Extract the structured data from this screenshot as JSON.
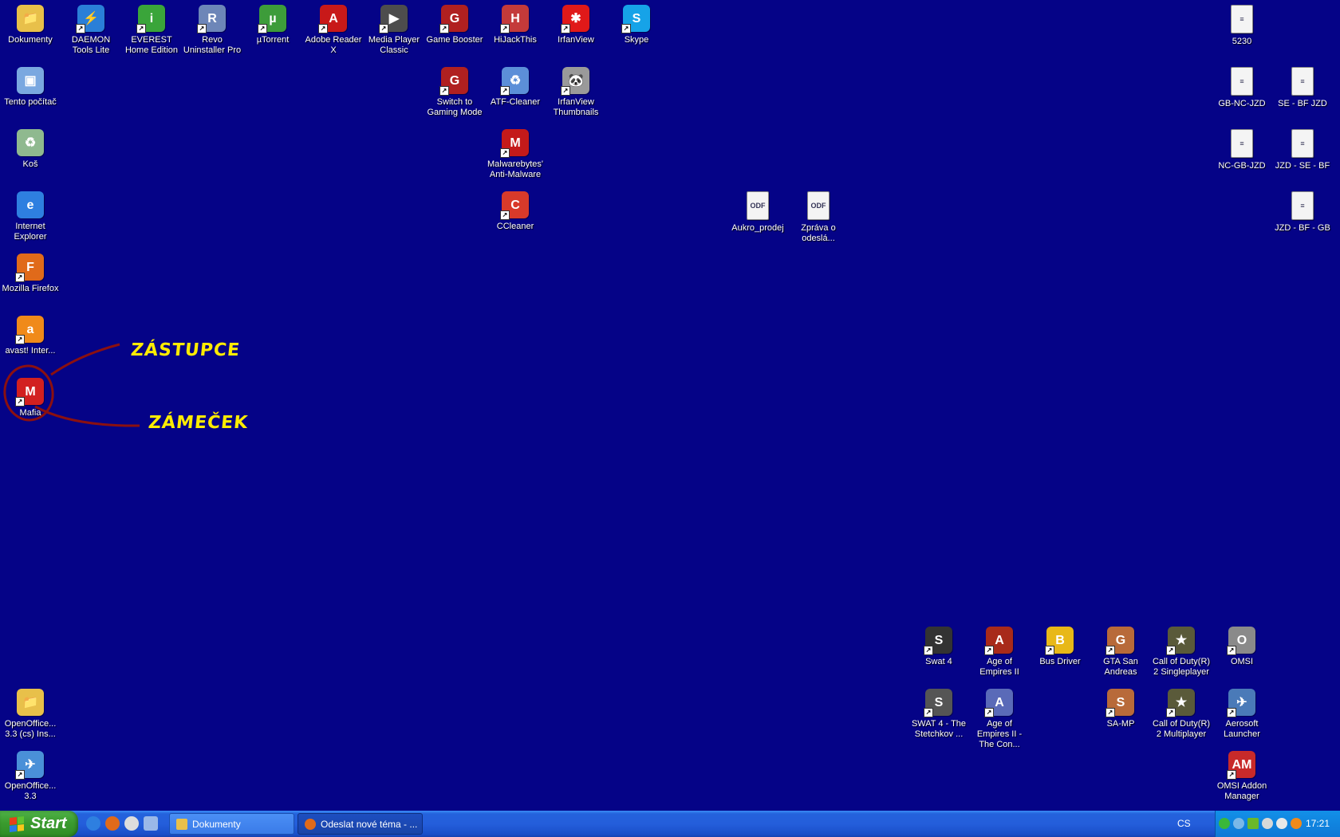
{
  "desktop": {
    "icons": [
      {
        "label": "Dokumenty",
        "abbr": "📁",
        "color": "#e8c04a",
        "shortcut": false
      },
      {
        "label": "DAEMON Tools Lite",
        "abbr": "⚡",
        "color": "#2a7fd8",
        "shortcut": true
      },
      {
        "label": "EVEREST Home Edition",
        "abbr": "i",
        "color": "#3aa53a",
        "shortcut": true
      },
      {
        "label": "Revo Uninstaller Pro",
        "abbr": "R",
        "color": "#6d86b8",
        "shortcut": true
      },
      {
        "label": "µTorrent",
        "abbr": "µ",
        "color": "#3d9c3a",
        "shortcut": true
      },
      {
        "label": "Adobe Reader X",
        "abbr": "A",
        "color": "#c81919",
        "shortcut": true
      },
      {
        "label": "Media Player Classic",
        "abbr": "▶",
        "color": "#4d4d4d",
        "shortcut": true
      },
      {
        "label": "Game Booster",
        "abbr": "G",
        "color": "#b02020",
        "shortcut": true
      },
      {
        "label": "HiJackThis",
        "abbr": "H",
        "color": "#c43a3a",
        "shortcut": true
      },
      {
        "label": "IrfanView",
        "abbr": "✱",
        "color": "#e01919",
        "shortcut": true
      },
      {
        "label": "Skype",
        "abbr": "S",
        "color": "#16a3e8",
        "shortcut": true
      },
      {
        "label": "Tento počítač",
        "abbr": "▣",
        "color": "#7aa8e0",
        "shortcut": false
      },
      {
        "label": "Koš",
        "abbr": "♻",
        "color": "#8fb98f",
        "shortcut": false
      },
      {
        "label": "Internet Explorer",
        "abbr": "e",
        "color": "#2e7fe0",
        "shortcut": false
      },
      {
        "label": "Mozilla Firefox",
        "abbr": "F",
        "color": "#e06a1a",
        "shortcut": true
      },
      {
        "label": "avast! Inter...",
        "abbr": "a",
        "color": "#f08a1a",
        "shortcut": true
      },
      {
        "label": "Mafia",
        "abbr": "M",
        "color": "#d22020",
        "shortcut": true
      },
      {
        "label": "Switch to Gaming Mode",
        "abbr": "G",
        "color": "#b02020",
        "shortcut": true
      },
      {
        "label": "ATF-Cleaner",
        "abbr": "♻",
        "color": "#5c8fd8",
        "shortcut": true
      },
      {
        "label": "IrfanView Thumbnails",
        "abbr": "🐼",
        "color": "#9a9a9a",
        "shortcut": true
      },
      {
        "label": "Malwarebytes' Anti-Malware",
        "abbr": "M",
        "color": "#c41a1a",
        "shortcut": true
      },
      {
        "label": "CCleaner",
        "abbr": "C",
        "color": "#d83a2a",
        "shortcut": true
      },
      {
        "label": "Aukro_prodej",
        "abbr": "ODF",
        "color": "#f4f4f4",
        "shortcut": false,
        "doc": true
      },
      {
        "label": "Zpráva o odeslá...",
        "abbr": "ODF",
        "color": "#f4f4f4",
        "shortcut": false,
        "doc": true
      },
      {
        "label": "5230",
        "abbr": "≡",
        "color": "#f4f4f4",
        "shortcut": false,
        "doc": true
      },
      {
        "label": "GB-NC-JZD",
        "abbr": "≡",
        "color": "#f4f4f4",
        "shortcut": false,
        "doc": true
      },
      {
        "label": "SE - BF JZD",
        "abbr": "≡",
        "color": "#f4f4f4",
        "shortcut": false,
        "doc": true
      },
      {
        "label": "NC-GB-JZD",
        "abbr": "≡",
        "color": "#f4f4f4",
        "shortcut": false,
        "doc": true
      },
      {
        "label": "JZD - SE - BF",
        "abbr": "≡",
        "color": "#f4f4f4",
        "shortcut": false,
        "doc": true
      },
      {
        "label": "JZD - BF - GB",
        "abbr": "≡",
        "color": "#f4f4f4",
        "shortcut": false,
        "doc": true
      },
      {
        "label": "OpenOffice... 3.3 (cs) Ins...",
        "abbr": "📁",
        "color": "#e8c04a",
        "shortcut": false
      },
      {
        "label": "OpenOffice... 3.3",
        "abbr": "✈",
        "color": "#4a90d8",
        "shortcut": true
      },
      {
        "label": "Swat 4",
        "abbr": "S",
        "color": "#333333",
        "shortcut": true
      },
      {
        "label": "Age of Empires II",
        "abbr": "A",
        "color": "#a82a1a",
        "shortcut": true
      },
      {
        "label": "Bus Driver",
        "abbr": "B",
        "color": "#e8b818",
        "shortcut": true
      },
      {
        "label": "GTA San Andreas",
        "abbr": "G",
        "color": "#b86a3a",
        "shortcut": true
      },
      {
        "label": "Call of Duty(R) 2 Singleplayer",
        "abbr": "★",
        "color": "#5a5a3a",
        "shortcut": true
      },
      {
        "label": "OMSI",
        "abbr": "O",
        "color": "#8a8a8a",
        "shortcut": true
      },
      {
        "label": "SWAT 4 - The Stetchkov ...",
        "abbr": "S",
        "color": "#555555",
        "shortcut": true
      },
      {
        "label": "Age of Empires II - The Con...",
        "abbr": "A",
        "color": "#5a6ab8",
        "shortcut": true
      },
      {
        "label": "SA-MP",
        "abbr": "S",
        "color": "#b86a3a",
        "shortcut": true
      },
      {
        "label": "Call of Duty(R) 2 Multiplayer",
        "abbr": "★",
        "color": "#5a5a3a",
        "shortcut": true
      },
      {
        "label": "Aerosoft Launcher",
        "abbr": "✈",
        "color": "#4a7ab8",
        "shortcut": true
      },
      {
        "label": "OMSI Addon Manager",
        "abbr": "AM",
        "color": "#c82a2a",
        "shortcut": true
      }
    ]
  },
  "annotations": {
    "shortcut_note": "ZÁSTUPCE",
    "lock_note": "ZÁMEČEK"
  },
  "taskbar": {
    "start_label": "Start",
    "tasks": [
      {
        "label": "Dokumenty",
        "active": false
      },
      {
        "label": "Odeslat nové téma - ...",
        "active": true
      }
    ],
    "language": "CS",
    "clock": "17:21"
  }
}
